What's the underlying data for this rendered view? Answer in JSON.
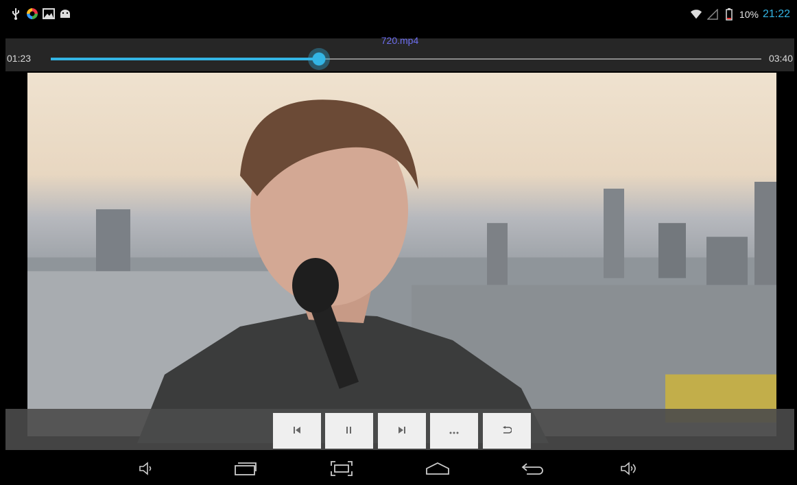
{
  "status_bar": {
    "battery_percent": "10%",
    "clock": "21:22",
    "left_icons": [
      "usb-icon",
      "app-notification-icon",
      "gallery-icon",
      "android-icon"
    ],
    "right_icons": [
      "wifi-icon",
      "cell-signal-icon",
      "battery-icon"
    ]
  },
  "player": {
    "title": "720.mp4",
    "elapsed": "01:23",
    "duration": "03:40",
    "progress_fraction": 0.377
  },
  "controls": [
    {
      "name": "previous-button",
      "icon": "skip-previous-icon"
    },
    {
      "name": "pause-button",
      "icon": "pause-icon"
    },
    {
      "name": "next-button",
      "icon": "skip-next-icon"
    },
    {
      "name": "more-button",
      "icon": "more-icon"
    },
    {
      "name": "back-to-list-button",
      "icon": "return-icon"
    }
  ],
  "nav_bar": [
    "volume-down-icon",
    "recent-apps-icon",
    "screenshot-icon",
    "home-icon",
    "back-icon",
    "volume-up-icon"
  ],
  "colors": {
    "accent": "#33b5e5",
    "title": "#6d6ef0"
  }
}
